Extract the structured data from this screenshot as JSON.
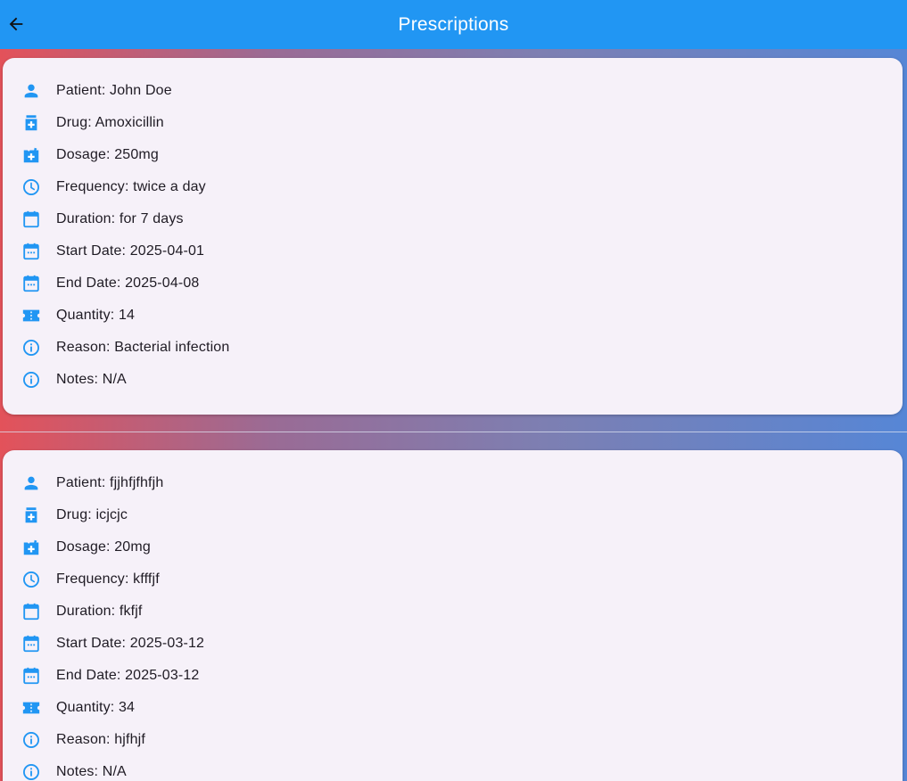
{
  "appbar": {
    "title": "Prescriptions"
  },
  "prescriptions": [
    {
      "patient": "Patient: John Doe",
      "drug": "Drug: Amoxicillin",
      "dosage": "Dosage: 250mg",
      "frequency": "Frequency: twice a day",
      "duration": "Duration: for 7 days",
      "start_date": "Start Date: 2025-04-01",
      "end_date": "End Date: 2025-04-08",
      "quantity": "Quantity: 14",
      "reason": "Reason: Bacterial infection",
      "notes": "Notes: N/A"
    },
    {
      "patient": "Patient: fjjhfjfhfjh",
      "drug": "Drug: icjcjc",
      "dosage": "Dosage: 20mg",
      "frequency": "Frequency: kfffjf",
      "duration": "Duration: fkfjf",
      "start_date": "Start Date: 2025-03-12",
      "end_date": "End Date: 2025-03-12",
      "quantity": "Quantity: 34",
      "reason": "Reason: hjfhjf",
      "notes": "Notes: N/A"
    }
  ],
  "icons": {
    "back": "arrow-back-icon",
    "patient": "person-icon",
    "drug": "medication-icon",
    "dosage": "vaccine-icon",
    "frequency": "clock-icon",
    "duration": "calendar-icon",
    "start_date": "calendar-event-icon",
    "end_date": "calendar-event-icon",
    "quantity": "ticket-icon",
    "reason": "info-icon",
    "notes": "info-icon"
  },
  "colors": {
    "appbar": "#2196f3",
    "icon": "#2196f3",
    "card": "#f6f1f9",
    "text": "#1f1b24"
  }
}
